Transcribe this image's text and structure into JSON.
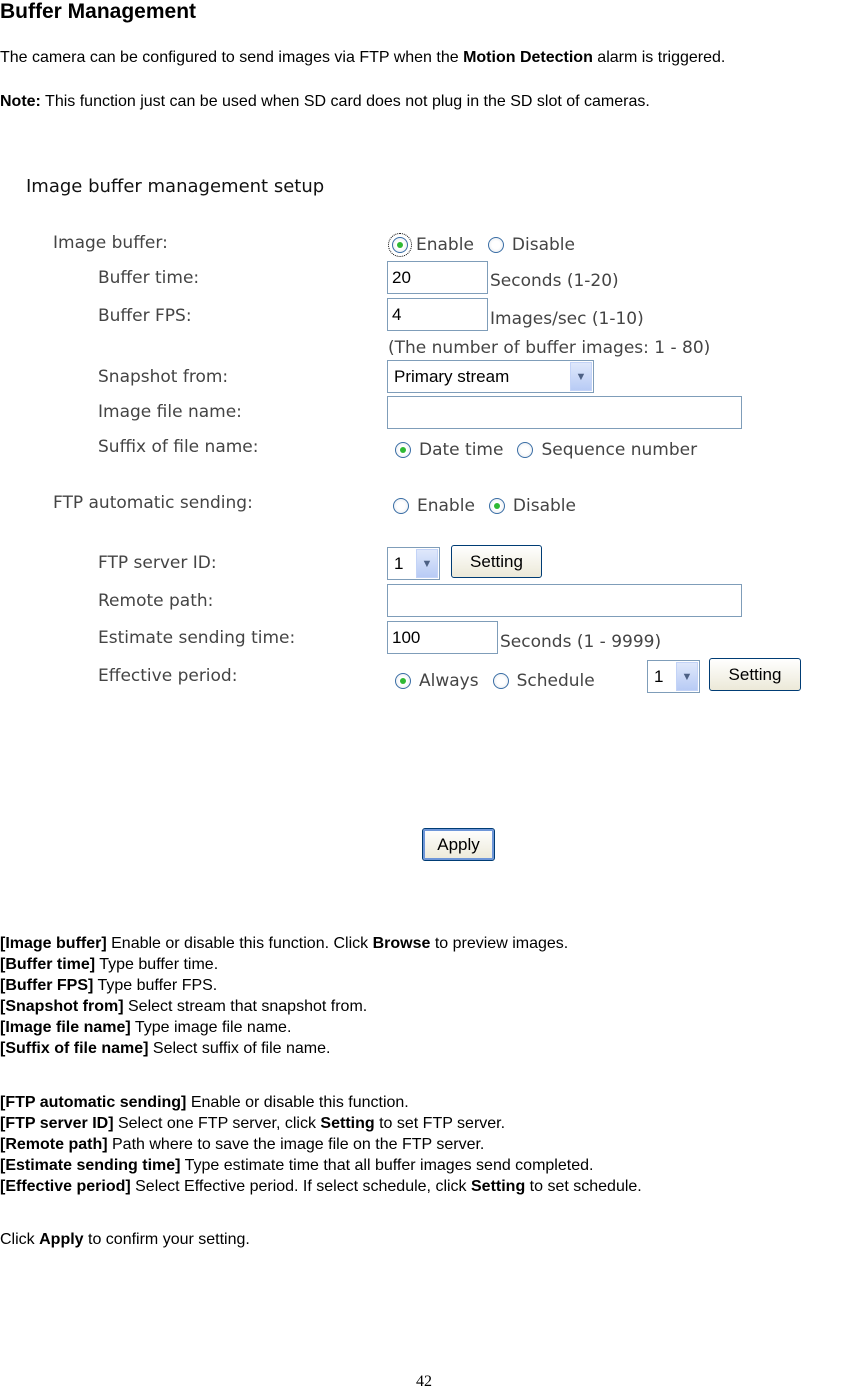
{
  "doc": {
    "title": "Buffer Management",
    "intro": {
      "before": "The camera can be configured to send images via FTP when the ",
      "bold": "Motion Detection",
      "after": " alarm is triggered."
    },
    "note": {
      "label": "Note:",
      "text": " This function just can be used when SD card does not plug in the SD slot of cameras."
    }
  },
  "ui": {
    "title": "Image buffer management setup",
    "image_buffer": {
      "label": "Image buffer:",
      "options": [
        "Enable",
        "Disable"
      ],
      "selected": "Enable"
    },
    "buffer_time": {
      "label": "Buffer time:",
      "value": "20",
      "hint": "Seconds (1-20)"
    },
    "buffer_fps": {
      "label": "Buffer FPS:",
      "value": "4",
      "hint": "Images/sec (1-10)"
    },
    "buffer_images_note": "(The number of buffer images:  1 - 80)",
    "snapshot_from": {
      "label": "Snapshot from:",
      "value": "Primary stream"
    },
    "image_file_name": {
      "label": "Image file name:",
      "value": ""
    },
    "suffix": {
      "label": "Suffix of file name:",
      "options": [
        "Date time",
        "Sequence number"
      ],
      "selected": "Date time"
    },
    "ftp_auto": {
      "label": "FTP automatic sending:",
      "options": [
        "Enable",
        "Disable"
      ],
      "selected": "Disable"
    },
    "ftp_server_id": {
      "label": "FTP server ID:",
      "value": "1",
      "button": "Setting"
    },
    "remote_path": {
      "label": "Remote path:",
      "value": ""
    },
    "estimate_time": {
      "label": "Estimate sending time:",
      "value": "100",
      "hint": "Seconds (1 - 9999)"
    },
    "effective_period": {
      "label": "Effective period:",
      "options": [
        "Always",
        "Schedule"
      ],
      "selected": "Always",
      "schedule_value": "1",
      "button": "Setting"
    },
    "apply": "Apply"
  },
  "descriptions": {
    "group1": [
      {
        "term": "[Image buffer]",
        "text": " Enable or disable this function. Click ",
        "bold2": "Browse",
        "text2": " to preview images."
      },
      {
        "term": "[Buffer time]",
        "text": " Type buffer time."
      },
      {
        "term": "[Buffer FPS]",
        "text": " Type buffer FPS."
      },
      {
        "term": "[Snapshot from]",
        "text": " Select stream that snapshot from."
      },
      {
        "term": "[Image file name]",
        "text": " Type image file name."
      },
      {
        "term": "[Suffix of file name]",
        "text": " Select suffix of file name."
      }
    ],
    "group2": [
      {
        "term": "[FTP automatic sending]",
        "text": " Enable or disable this function."
      },
      {
        "term": "[FTP server ID]",
        "text": " Select one FTP server, click ",
        "bold2": "Setting",
        "text2": " to set FTP server."
      },
      {
        "term": "[Remote path]",
        "text": " Path where to save the image file on the FTP server."
      },
      {
        "term": "[Estimate sending time]",
        "text": " Type estimate time that all buffer images send completed."
      },
      {
        "term": "[Effective period]",
        "text": " Select Effective period. If select schedule, click ",
        "bold2": "Setting",
        "text2": " to set schedule."
      }
    ],
    "closing": {
      "before": "Click ",
      "bold": "Apply",
      "after": " to confirm your setting."
    }
  },
  "page_number": "42"
}
